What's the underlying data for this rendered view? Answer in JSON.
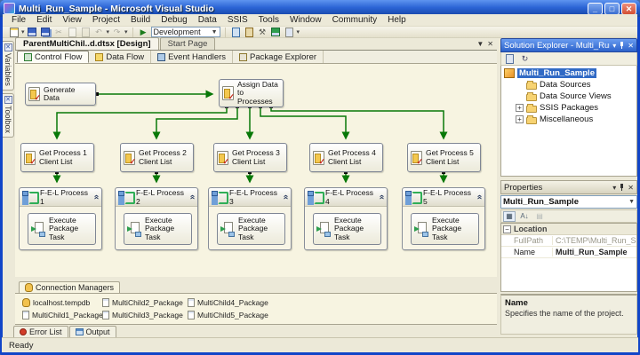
{
  "window": {
    "title": "Multi_Run_Sample - Microsoft Visual Studio"
  },
  "menu": {
    "items": [
      "File",
      "Edit",
      "View",
      "Project",
      "Build",
      "Debug",
      "Data",
      "SSIS",
      "Tools",
      "Window",
      "Community",
      "Help"
    ]
  },
  "toolbar": {
    "combo_value": "Development"
  },
  "document_tabs": [
    {
      "label": "ParentMultiChil..d.dtsx [Design]",
      "active": true
    },
    {
      "label": "Start Page"
    }
  ],
  "designer_tabs": [
    {
      "label": "Control Flow",
      "active": true,
      "kind": "controlflow"
    },
    {
      "label": "Data Flow",
      "kind": "dataflow"
    },
    {
      "label": "Event Handlers",
      "kind": "eventhandlers"
    },
    {
      "label": "Package Explorer",
      "kind": "packageexplorer"
    }
  ],
  "side_tabs": [
    {
      "label": "Variables",
      "kind": "variables"
    },
    {
      "label": "Toolbox",
      "kind": "toolbox"
    }
  ],
  "diagram": {
    "generate_label": "Generate Data",
    "assign_label": "Assign Data to Processes",
    "columns": [
      {
        "task_label": "Get Process 1 Client List",
        "container_label": "F-E-L Process 1",
        "inner_label": "Execute Package Task"
      },
      {
        "task_label": "Get Process 2 Client List",
        "container_label": "F-E-L Process 2",
        "inner_label": "Execute Package Task"
      },
      {
        "task_label": "Get Process 3 Client List",
        "container_label": "F-E-L Process 3",
        "inner_label": "Execute Package Task"
      },
      {
        "task_label": "Get Process 4 Client List",
        "container_label": "F-E-L Process 4",
        "inner_label": "Execute Package Task"
      },
      {
        "task_label": "Get Process 5 Client List",
        "container_label": "F-E-L Process 5",
        "inner_label": "Execute Package Task"
      }
    ]
  },
  "connection_managers": {
    "tab_label": "Connection Managers",
    "items": [
      {
        "label": "localhost.tempdb",
        "kind": "db"
      },
      {
        "label": "MultiChild2_Package",
        "kind": "pkg"
      },
      {
        "label": "MultiChild4_Package",
        "kind": "pkg"
      },
      {
        "label": "MultiChild1_Package",
        "kind": "pkg"
      },
      {
        "label": "MultiChild3_Package",
        "kind": "pkg"
      },
      {
        "label": "MultiChild5_Package",
        "kind": "pkg"
      }
    ]
  },
  "bottom_tabs": [
    {
      "label": "Error List",
      "kind": "errorlist"
    },
    {
      "label": "Output",
      "kind": "output"
    }
  ],
  "status_bar": {
    "text": "Ready"
  },
  "solution_explorer": {
    "title": "Solution Explorer - Multi_Run_Sample",
    "root_label": "Multi_Run_Sample",
    "items": [
      {
        "label": "Data Sources"
      },
      {
        "label": "Data Source Views"
      },
      {
        "label": "SSIS Packages",
        "expand": true
      },
      {
        "label": "Miscellaneous",
        "expand": true
      }
    ]
  },
  "properties": {
    "title": "Properties",
    "object_name": "Multi_Run_Sample",
    "category": "Location",
    "rows": [
      {
        "name": "FullPath",
        "value": "C:\\TEMP\\Multi_Run_Sample\\M",
        "kind": "muted"
      },
      {
        "name": "Name",
        "value": "Multi_Run_Sample",
        "kind": "bold"
      }
    ],
    "description_title": "Name",
    "description_text": "Specifies the name of the project."
  }
}
